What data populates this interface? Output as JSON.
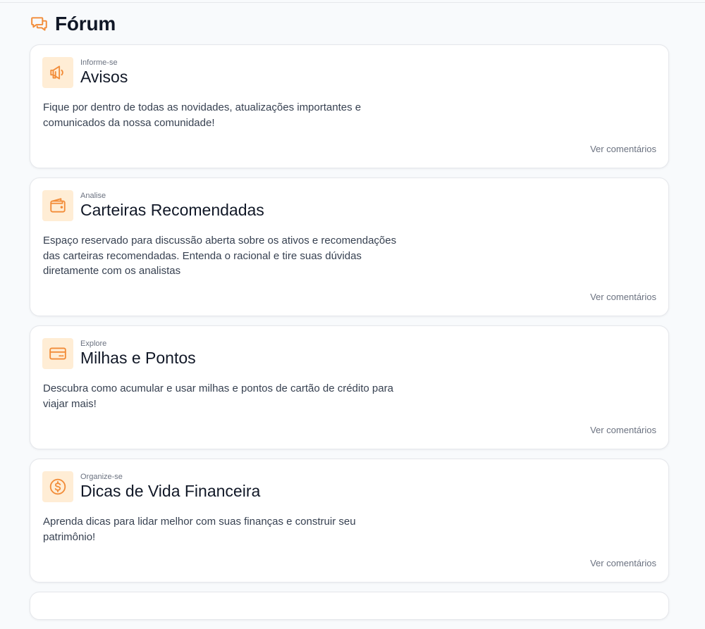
{
  "page": {
    "title": "Fórum",
    "accent_color": "#f28c38",
    "icon": "chat-bubbles-icon"
  },
  "forums": [
    {
      "eyebrow": "Informe-se",
      "title": "Avisos",
      "description": "Fique por dentro de todas as novidades, atualizações importantes e comunicados da nossa comunidade!",
      "link": "Ver comentários",
      "icon": "megaphone-icon"
    },
    {
      "eyebrow": "Analise",
      "title": "Carteiras Recomendadas",
      "description": "Espaço reservado para discussão aberta sobre os ativos e recomendações das carteiras recomendadas. Entenda o racional e tire suas dúvidas diretamente com os analistas",
      "link": "Ver comentários",
      "icon": "wallet-icon"
    },
    {
      "eyebrow": "Explore",
      "title": "Milhas e Pontos",
      "description": "Descubra como acumular e usar milhas e pontos de cartão de crédito para viajar mais!",
      "link": "Ver comentários",
      "icon": "credit-card-icon"
    },
    {
      "eyebrow": "Organize-se",
      "title": "Dicas de Vida Financeira",
      "description": "Aprenda dicas para lidar melhor com suas finanças e construir seu patrimônio!",
      "link": "Ver comentários",
      "icon": "dollar-coin-icon"
    }
  ]
}
